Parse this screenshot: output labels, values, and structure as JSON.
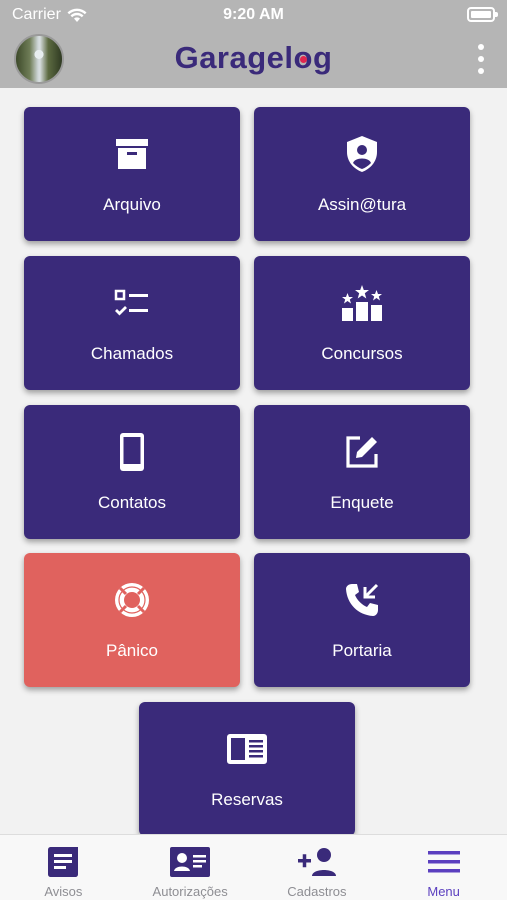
{
  "status_bar": {
    "carrier": "Carrier",
    "time": "9:20 AM"
  },
  "header": {
    "logo_text_a": "Garagel",
    "logo_text_o": "o",
    "logo_text_b": "g"
  },
  "tiles": [
    {
      "label": "Arquivo",
      "icon": "archive-icon"
    },
    {
      "label": "Assin@tura",
      "icon": "shield-user-icon"
    },
    {
      "label": "Chamados",
      "icon": "checklist-icon"
    },
    {
      "label": "Concursos",
      "icon": "podium-stars-icon"
    },
    {
      "label": "Contatos",
      "icon": "smartphone-icon"
    },
    {
      "label": "Enquete",
      "icon": "edit-square-icon"
    },
    {
      "label": "Pânico",
      "icon": "lifebuoy-icon"
    },
    {
      "label": "Portaria",
      "icon": "phone-incoming-icon"
    },
    {
      "label": "Reservas",
      "icon": "newspaper-icon"
    }
  ],
  "tab_bar": [
    {
      "label": "Avisos",
      "icon": "notice-icon"
    },
    {
      "label": "Autorizações",
      "icon": "id-card-icon"
    },
    {
      "label": "Cadastros",
      "icon": "add-person-icon"
    },
    {
      "label": "Menu",
      "icon": "hamburger-icon",
      "active": true
    }
  ],
  "colors": {
    "tile": "#3a2a7a",
    "panic": "#e0625e",
    "header": "#b5b5b5",
    "active_tab": "#5b3fbf",
    "inactive_tab": "#8e8e93"
  }
}
